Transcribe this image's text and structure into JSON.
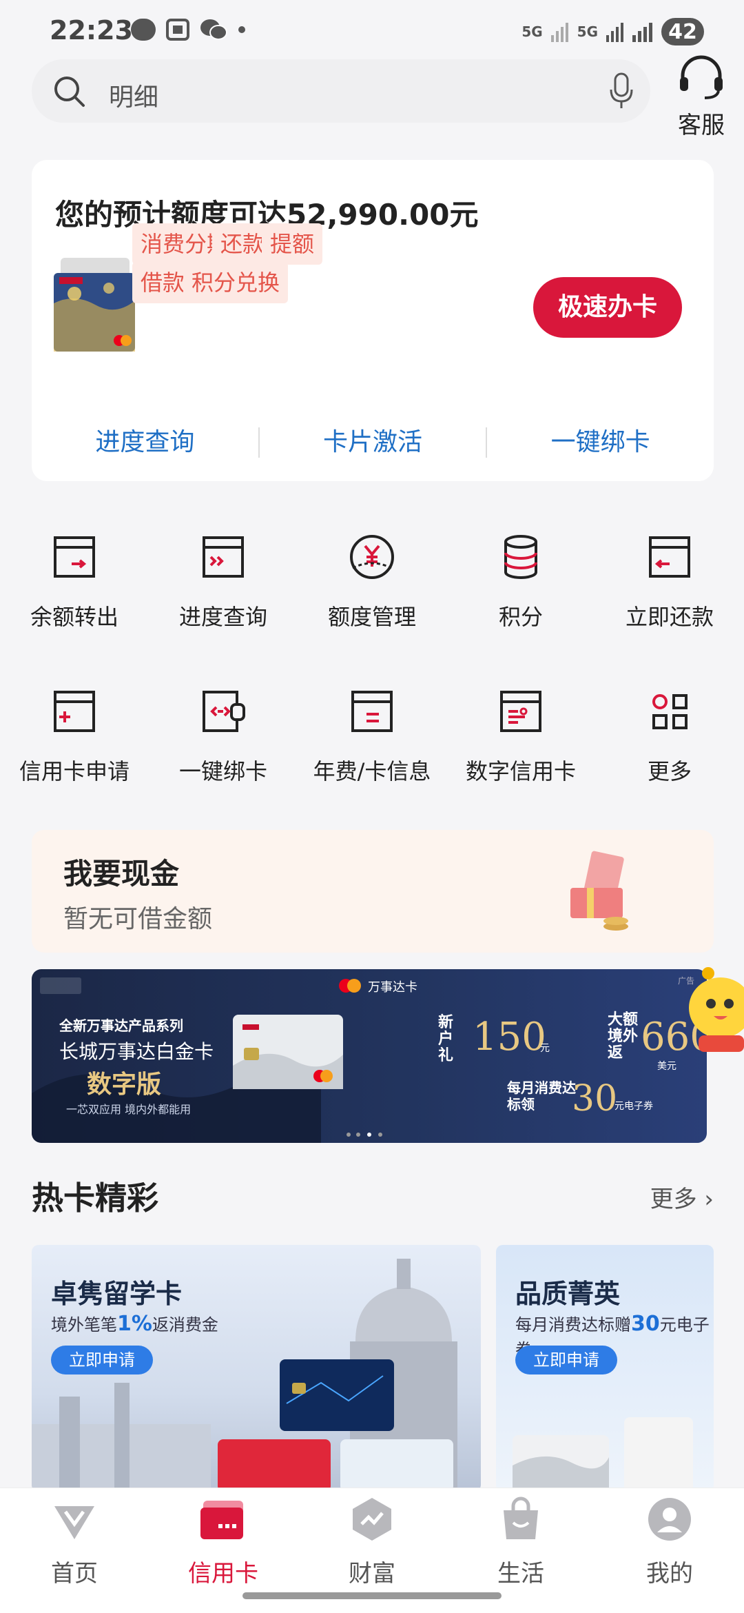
{
  "status_bar": {
    "time": "22:23",
    "signal_1": "5G",
    "signal_2": "5G",
    "battery": "42"
  },
  "search": {
    "placeholder": "明细"
  },
  "service": {
    "label": "客服"
  },
  "credit_card_panel": {
    "title": "您的预计额度可达52,990.00元",
    "tags": [
      "消费分期",
      "还款",
      "提额",
      "借款",
      "积分兑换"
    ],
    "apply_button": "极速办卡",
    "links": [
      "进度查询",
      "卡片激活",
      "一键绑卡"
    ]
  },
  "grid_row_1": [
    {
      "label": "余额转出",
      "icon": "transfer-out-icon"
    },
    {
      "label": "进度查询",
      "icon": "progress-query-icon"
    },
    {
      "label": "额度管理",
      "icon": "yuan-icon"
    },
    {
      "label": "积分",
      "icon": "points-stack-icon"
    },
    {
      "label": "立即还款",
      "icon": "repay-icon"
    }
  ],
  "grid_row_2": [
    {
      "label": "信用卡申请",
      "icon": "card-apply-icon"
    },
    {
      "label": "一键绑卡",
      "icon": "link-card-icon"
    },
    {
      "label": "年费/卡信息",
      "icon": "card-info-icon"
    },
    {
      "label": "数字信用卡",
      "icon": "digital-card-icon"
    },
    {
      "label": "更多",
      "icon": "more-grid-icon"
    }
  ],
  "cash": {
    "title": "我要现金",
    "subtitle": "暂无可借金额"
  },
  "banner": {
    "brand": "万事达卡",
    "series": "全新万事达产品系列",
    "card_name": "长城万事达白金卡",
    "version": "数字版",
    "tagline": "一芯双应用 境内外都能用",
    "new_gift_label": "新户礼",
    "new_gift_value": "150",
    "new_gift_unit": "元",
    "cashback_label": "大额境外返",
    "cashback_value": "660",
    "cashback_unit": "美元",
    "monthly_label": "每月消费达标领",
    "monthly_value": "30",
    "monthly_unit": "元电子券",
    "ad": "广告"
  },
  "hot_cards": {
    "title": "热卡精彩",
    "more": "更多",
    "items": [
      {
        "title": "卓隽留学卡",
        "sub_prefix": "境外笔笔",
        "sub_highlight": "1%",
        "sub_suffix": "返消费金",
        "button": "立即申请"
      },
      {
        "title": "品质菁英",
        "sub_prefix": "每月消费达标赠",
        "sub_highlight": "30",
        "sub_suffix": "元电子券",
        "button": "立即申请"
      }
    ]
  },
  "tabbar": [
    {
      "label": "首页",
      "icon": "home-icon"
    },
    {
      "label": "信用卡",
      "icon": "credit-card-icon"
    },
    {
      "label": "财富",
      "icon": "wealth-icon"
    },
    {
      "label": "生活",
      "icon": "shopping-bag-icon"
    },
    {
      "label": "我的",
      "icon": "profile-icon"
    }
  ],
  "colors": {
    "brand_red": "#d9173b",
    "link_blue": "#1f6fc5",
    "tag_bg": "#fde9e4",
    "tag_text": "#e4554a"
  }
}
